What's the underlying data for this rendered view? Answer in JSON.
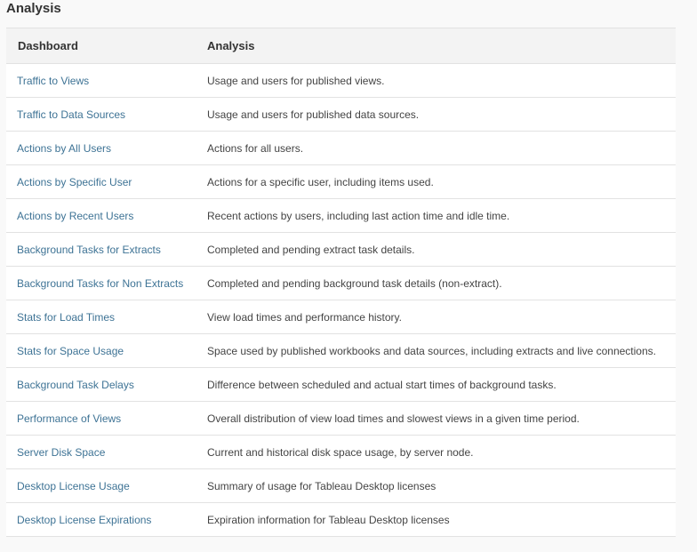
{
  "page": {
    "title": "Analysis"
  },
  "table": {
    "headers": {
      "dashboard": "Dashboard",
      "analysis": "Analysis"
    },
    "rows": [
      {
        "dashboard": "Traffic to Views",
        "analysis": "Usage and users for published views."
      },
      {
        "dashboard": "Traffic to Data Sources",
        "analysis": "Usage and users for published data sources."
      },
      {
        "dashboard": "Actions by All Users",
        "analysis": "Actions for all users."
      },
      {
        "dashboard": "Actions by Specific User",
        "analysis": "Actions for a specific user, including items used."
      },
      {
        "dashboard": "Actions by Recent Users",
        "analysis": "Recent actions by users, including last action time and idle time."
      },
      {
        "dashboard": "Background Tasks for Extracts",
        "analysis": "Completed and pending extract task details."
      },
      {
        "dashboard": "Background Tasks for Non Extracts",
        "analysis": "Completed and pending background task details (non-extract)."
      },
      {
        "dashboard": "Stats for Load Times",
        "analysis": "View load times and performance history."
      },
      {
        "dashboard": "Stats for Space Usage",
        "analysis": "Space used by published workbooks and data sources, including extracts and live connections."
      },
      {
        "dashboard": "Background Task Delays",
        "analysis": "Difference between scheduled and actual start times of background tasks."
      },
      {
        "dashboard": "Performance of Views",
        "analysis": "Overall distribution of view load times and slowest views in a given time period."
      },
      {
        "dashboard": "Server Disk Space",
        "analysis": "Current and historical disk space usage, by server node."
      },
      {
        "dashboard": "Desktop License Usage",
        "analysis": "Summary of usage for Tableau Desktop licenses"
      },
      {
        "dashboard": "Desktop License Expirations",
        "analysis": "Expiration information for Tableau Desktop licenses"
      }
    ]
  },
  "colors": {
    "link": "#3e7395",
    "text": "#444444",
    "header_bg": "#f3f3f3",
    "page_bg": "#f9f9f9",
    "border": "#e2e2e2"
  }
}
